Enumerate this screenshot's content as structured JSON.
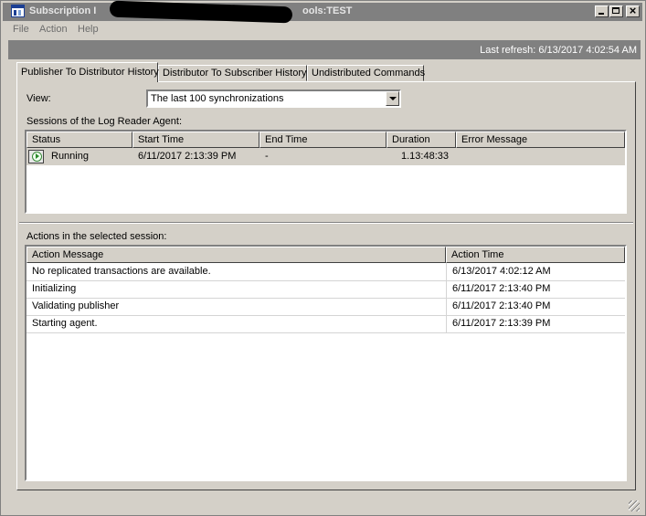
{
  "window": {
    "title_prefix": "Subscription I",
    "title_suffix": "ools:TEST"
  },
  "menu": {
    "file": "File",
    "action": "Action",
    "help": "Help"
  },
  "refresh": {
    "text": "Last refresh: 6/13/2017 4:02:54 AM"
  },
  "tabs": [
    {
      "label": "Publisher To Distributor History",
      "active": true
    },
    {
      "label": "Distributor To Subscriber History",
      "active": false
    },
    {
      "label": "Undistributed Commands",
      "active": false
    }
  ],
  "view": {
    "label": "View:",
    "selected": "The last 100 synchronizations"
  },
  "sessions": {
    "label": "Sessions of the Log Reader Agent:",
    "columns": [
      "Status",
      "Start Time",
      "End Time",
      "Duration",
      "Error Message"
    ],
    "rows": [
      {
        "status": "Running",
        "start_time": "6/11/2017 2:13:39 PM",
        "end_time": "-",
        "duration": "1.13:48:33",
        "error_message": ""
      }
    ]
  },
  "actions": {
    "label": "Actions in the selected session:",
    "columns": [
      "Action Message",
      "Action Time"
    ],
    "rows": [
      {
        "message": "No replicated transactions are available.",
        "time": "6/13/2017 4:02:12 AM"
      },
      {
        "message": "Initializing",
        "time": "6/11/2017 2:13:40 PM"
      },
      {
        "message": "Validating publisher",
        "time": "6/11/2017 2:13:40 PM"
      },
      {
        "message": "Starting agent.",
        "time": "6/11/2017 2:13:39 PM"
      }
    ]
  }
}
